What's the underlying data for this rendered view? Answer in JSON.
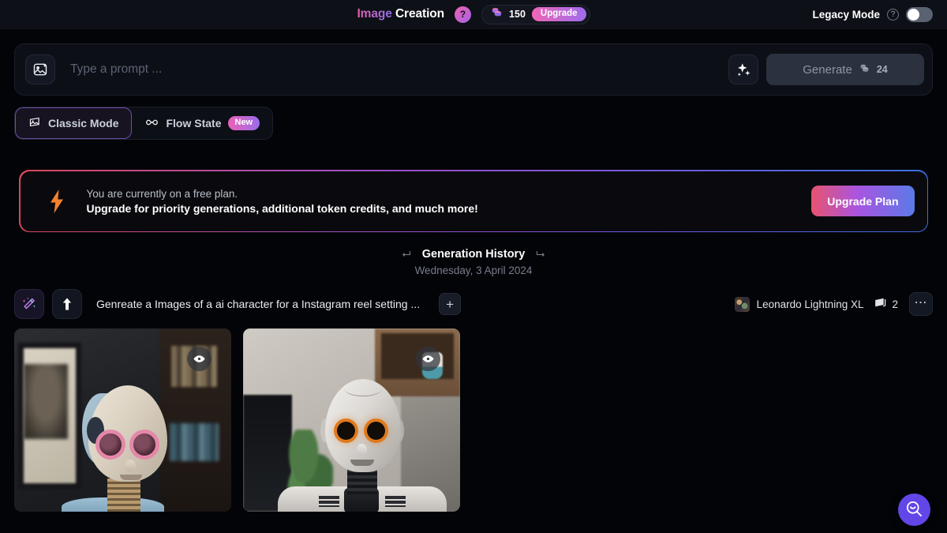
{
  "topbar": {
    "title_part1": "Image",
    "title_part2": "Creation",
    "help_glyph": "?",
    "token_count": "150",
    "upgrade_chip_label": "Upgrade",
    "legacy_mode_label": "Legacy Mode",
    "legacy_help_glyph": "?",
    "legacy_toggle_state": "off"
  },
  "prompt": {
    "placeholder": "Type a prompt ...",
    "value": "",
    "image_icon": "image-sparkle-icon",
    "enhance_icon": "sparkles-icon",
    "generate_label": "Generate",
    "generate_cost": "24"
  },
  "tabs": [
    {
      "label": "Classic Mode",
      "icon": "classic-mode-icon",
      "active": true,
      "badge": ""
    },
    {
      "label": "Flow State",
      "icon": "infinity-icon",
      "active": false,
      "badge": "New"
    }
  ],
  "banner": {
    "icon": "lightning-bolt-icon",
    "line1": "You are currently on a free plan.",
    "line2": "Upgrade for priority generations, additional token credits, and much more!",
    "button_label": "Upgrade Plan",
    "border_gradient": [
      "#d9485c",
      "#a24fc4",
      "#8253d8",
      "#3a6fe0"
    ]
  },
  "history": {
    "title": "Generation History",
    "arrow_left": "⮠",
    "arrow_right": "⮡",
    "date": "Wednesday, 3 April 2024"
  },
  "generation": {
    "wand_icon": "magic-wand-icon",
    "upload_icon": "arrow-up-icon",
    "prompt_text": "Genreate a Images of a ai character for a Instagram reel setting ...",
    "expand_label": "+",
    "model_name": "Leonardo Lightning XL",
    "image_count": "2",
    "more_label": "⋯",
    "images": [
      {
        "alt": "AI robot character wearing pink round sunglasses in a study room",
        "eye_icon": "eye-icon"
      },
      {
        "alt": "White humanoid AI robot with glowing orange eyes in a living room",
        "eye_icon": "eye-icon"
      }
    ]
  },
  "support": {
    "icon": "search-smile-icon",
    "accent": "#6246e8"
  }
}
